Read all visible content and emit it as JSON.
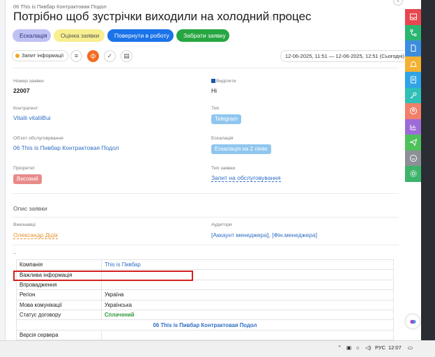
{
  "header": {
    "breadcrumb": "06 This is Пивбар Контрактовая Подол",
    "title": "Потрібно щоб зустрічки виходили на холодний процес",
    "star_glyph": "☆",
    "more_glyph": "⋯"
  },
  "actions": {
    "escalation": "Ескалація",
    "rate": "Оцінка заявки",
    "return": "Повернути в роботу",
    "take": "Забрати заявку"
  },
  "toolbar": {
    "request_info": "Запит інформації",
    "date_range": "12-06-2025, 11:51 — 12-06-2025, 12:51  (Сьогодні)"
  },
  "fields": {
    "ticket_number_label": "Номер заявки",
    "ticket_number": "22007",
    "highlight_label": "Виділити",
    "highlight_value": "Ні",
    "contractor_label": "Контрагент:",
    "contractor": "Vitalii vitaliiBui",
    "type_label": "Тип",
    "type_value": "Telegram",
    "service_object_label": "Об'єкт обслуговування",
    "service_object": "06 This is Пивбар Контрактовая Подол",
    "escalation_label": "Ескалація",
    "escalation_value": "Ескалація на 2 лінію",
    "priority_label": "Пріоритет",
    "priority_value": "Високий",
    "ticket_type_label": "Тип заявки",
    "ticket_type": "Запит на обслуговування",
    "description_title": "Опис заявки",
    "assignee_label": "Виконавці",
    "assignee": "Олександр Дідік",
    "auditors_label": "Аудитори",
    "auditors": "[Аккаунт менеджера], [Фін.менеджера]",
    "dash": "–"
  },
  "table": {
    "rows": [
      {
        "key": "Компанія",
        "value": "This is Пивбар"
      },
      {
        "key": "Важлива інформація",
        "value": ""
      },
      {
        "key": "Впровадження",
        "value": ""
      },
      {
        "key": "Регіон",
        "value": "Україна"
      },
      {
        "key": "Мова комунікації",
        "value": "Українська"
      },
      {
        "key": "Статус договору",
        "value": "Сплачений"
      }
    ],
    "merged_row": "06 This is Пивбар Контрактовая Подол",
    "last_row_key": "Версія сервера"
  },
  "taskbar": {
    "language": "РУС",
    "time": "12:07"
  },
  "colors": {
    "accent_orange": "#f26b21",
    "link_blue": "#2f6fc4",
    "highlight_red": "#d42020"
  },
  "sidebar_icons": [
    "inbox-icon",
    "branch-icon",
    "document-icon",
    "bell-icon",
    "clipboard-icon",
    "key-icon",
    "user-icon",
    "chart-icon",
    "send-icon",
    "chat-icon",
    "gear-icon"
  ]
}
